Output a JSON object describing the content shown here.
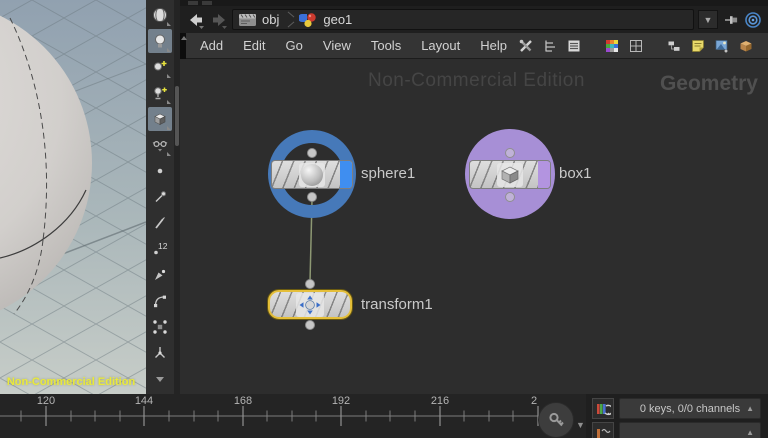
{
  "path_bar": {
    "breadcrumb": [
      {
        "icon": "obj-network-icon",
        "label": "obj"
      },
      {
        "icon": "geometry-icon",
        "label": "geo1"
      }
    ]
  },
  "menu_bar": {
    "items": [
      "Add",
      "Edit",
      "Go",
      "View",
      "Tools",
      "Layout",
      "Help"
    ]
  },
  "network_canvas": {
    "watermark_center": "Non-Commercial Edition",
    "watermark_corner": "Geometry",
    "nodes": [
      {
        "name": "sphere1",
        "type": "sphere",
        "selection": "blue-ring",
        "flag_color": "#3f8ef0"
      },
      {
        "name": "box1",
        "type": "box",
        "selection": "purple-circle",
        "flag_color": "#b394e0"
      },
      {
        "name": "transform1",
        "type": "transform",
        "selection": "yellow-outline"
      }
    ],
    "wires": [
      {
        "from": "sphere1",
        "to": "transform1",
        "color": "#8d9873"
      }
    ]
  },
  "viewport": {
    "watermark": "Non-Commercial Edition"
  },
  "timeline": {
    "tick_labels": [
      "120",
      "144",
      "168",
      "192",
      "216",
      "2"
    ]
  },
  "playbar": {
    "keys_summary": "0 keys, 0/0 channels"
  },
  "colors": {
    "selection_blue": "#4679b9",
    "selection_purple": "#a78fd6",
    "current_yellow": "#e5bf3a",
    "display_flag_blue": "#3f8ef0",
    "wire_green": "#8d9873",
    "canvas_bg": "#2d2d2d"
  }
}
